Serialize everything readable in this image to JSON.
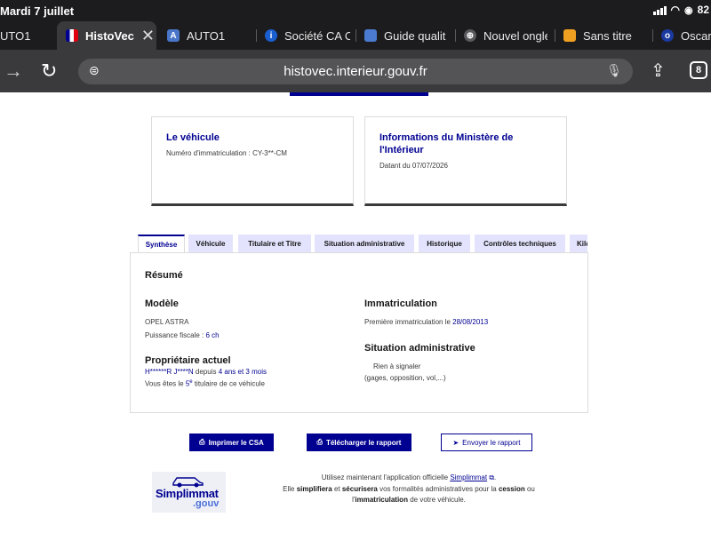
{
  "status": {
    "date": "Mardi 7 juillet",
    "battery": "82"
  },
  "tabs": [
    {
      "label": "UTO1",
      "fav": "",
      "color": "#1c1c1e"
    },
    {
      "label": "HistoVec",
      "fav": "",
      "color": "#ffffff",
      "active": true
    },
    {
      "label": "AUTO1",
      "fav": "A",
      "color": "#4a76c9"
    },
    {
      "label": "Société CA C",
      "fav": "i",
      "color": "#1a5fd0"
    },
    {
      "label": "Guide qualit",
      "fav": "",
      "color": "#4a7bd0"
    },
    {
      "label": "Nouvel ongle",
      "fav": "⊕",
      "color": "#5a5a5e"
    },
    {
      "label": "Sans titre",
      "fav": "",
      "color": "#f0a020"
    },
    {
      "label": "Oscar",
      "fav": "o",
      "color": "#1a3aa0"
    }
  ],
  "toolbar": {
    "url": "histovec.interieur.gouv.fr",
    "tab_count": "8"
  },
  "cards": {
    "vehicle": {
      "title": "Le véhicule",
      "text": "Numéro d'immatriculation : CY-3**-CM"
    },
    "ministry": {
      "title": "Informations du Ministère de l'Intérieur",
      "text": "Datant du 07/07/2026"
    }
  },
  "page_tabs": [
    "Synthèse",
    "Véhicule",
    "Titulaire et Titre",
    "Situation administrative",
    "Historique",
    "Contrôles techniques",
    "Kilo"
  ],
  "summary": {
    "heading": "Résumé",
    "model_heading": "Modèle",
    "model": "OPEL ASTRA",
    "fiscal_label": "Puissance fiscale : ",
    "fiscal_value": "6 ch",
    "owner_heading": "Propriétaire actuel",
    "owner_name": "H******R J****N",
    "owner_since_label": " depuis ",
    "owner_since": "4 ans et 3 mois",
    "owner_rank_pre": "Vous êtes le ",
    "owner_rank": "5",
    "owner_rank_sup": "e",
    "owner_rank_post": " titulaire de ce véhicule",
    "registration_heading": "Immatriculation",
    "first_registration_label": "Première immatriculation le ",
    "first_registration_date": "28/08/2013",
    "admin_heading": "Situation administrative",
    "admin_status": "Rien à signaler",
    "admin_detail": "(gages, opposition, vol,...)"
  },
  "buttons": {
    "print": "Imprimer le CSA",
    "download": "Télécharger le rapport",
    "send": "Envoyer le rapport"
  },
  "promo": {
    "logo_name": "Simplimmat",
    "logo_suffix": ".gouv",
    "line1_pre": "Utilisez maintenant l'application officielle ",
    "line1_link": "Simplimmat",
    "line1_post": ".",
    "line2_a": "Elle ",
    "line2_b": "simplifiera",
    "line2_c": " et ",
    "line2_d": "sécurisera",
    "line2_e": " vos formalités administratives pour la ",
    "line2_f": "cession",
    "line2_g": " ou",
    "line3_a": "l'",
    "line3_b": "immatriculation",
    "line3_c": " de votre véhicule."
  }
}
